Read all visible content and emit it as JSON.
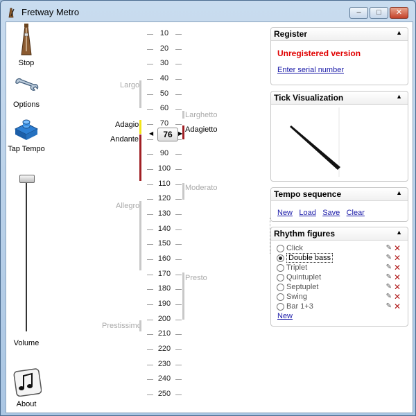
{
  "window": {
    "title": "Fretway Metro",
    "buttons": {
      "min": "–",
      "max": "□",
      "close": "✕"
    }
  },
  "toolbar": {
    "stop": {
      "label": "Stop",
      "icon": "metronome-icon"
    },
    "options": {
      "label": "Options",
      "icon": "wrench-icon"
    },
    "tap": {
      "label": "Tap Tempo",
      "icon": "tap-button-icon"
    },
    "volume": {
      "label": "Volume",
      "level": 1.0
    },
    "about": {
      "label": "About",
      "icon": "music-note-icon"
    }
  },
  "scale": {
    "ticks": [
      "10",
      "20",
      "30",
      "40",
      "50",
      "60",
      "70",
      "80",
      "90",
      "100",
      "110",
      "120",
      "130",
      "140",
      "150",
      "160",
      "170",
      "180",
      "190",
      "200",
      "210",
      "220",
      "230",
      "240",
      "250"
    ],
    "current": "76",
    "left_terms": [
      "Largo",
      "Adagio",
      "Andante",
      "Allegro",
      "Prestissimo"
    ],
    "right_terms": [
      "Larghetto",
      "Adagietto",
      "Moderato",
      "Presto"
    ],
    "colors": {
      "adagio": "#f2e418",
      "andante": "#a01f24",
      "inactive": "#c8c8c8"
    }
  },
  "register": {
    "title": "Register",
    "status": "Unregistered version",
    "link": "Enter serial number",
    "status_color": "#e00000"
  },
  "tick_vis": {
    "title": "Tick Visualization"
  },
  "tempo_sequence": {
    "title": "Tempo sequence",
    "links": [
      "New",
      "Load",
      "Save",
      "Clear"
    ]
  },
  "rhythm": {
    "title": "Rhythm figures",
    "items": [
      {
        "name": "Click",
        "selected": false
      },
      {
        "name": "Double bass",
        "selected": true
      },
      {
        "name": "Triplet",
        "selected": false
      },
      {
        "name": "Quintuplet",
        "selected": false
      },
      {
        "name": "Septuplet",
        "selected": false
      },
      {
        "name": "Swing",
        "selected": false
      },
      {
        "name": "Bar 1+3",
        "selected": false
      }
    ],
    "new_link": "New"
  }
}
